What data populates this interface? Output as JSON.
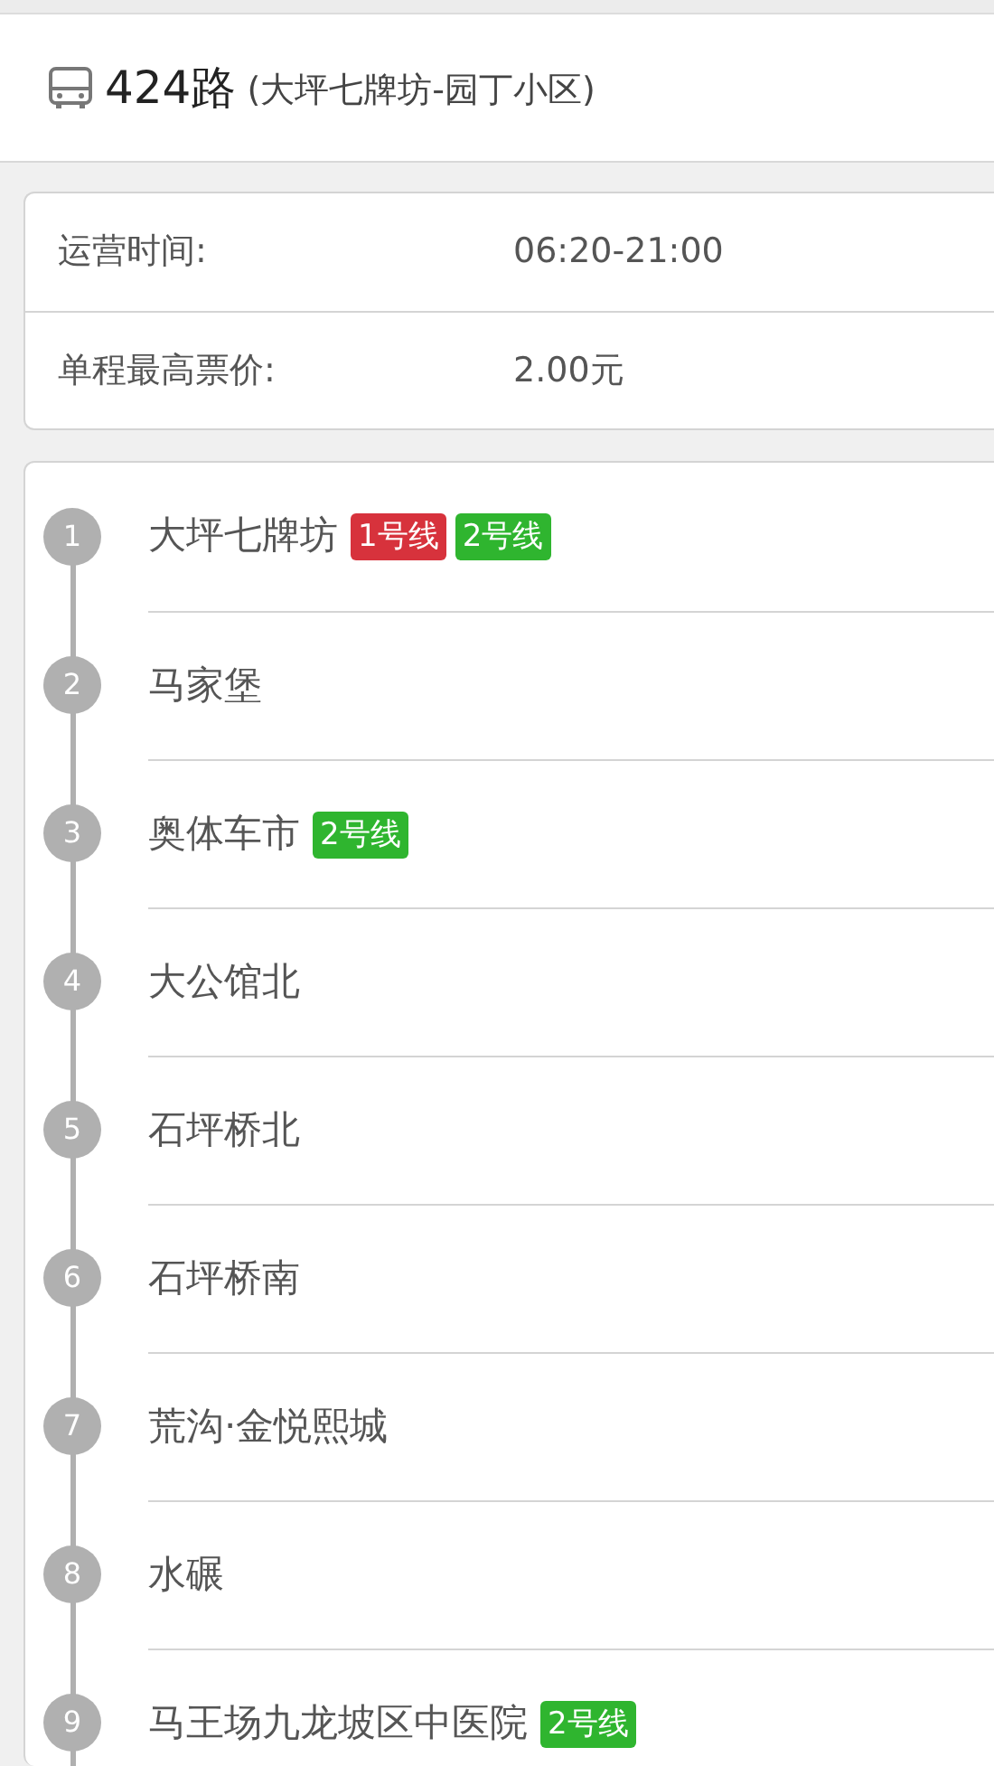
{
  "route": {
    "number": "424路",
    "terminals": "(大坪七牌坊-园丁小区)"
  },
  "info": [
    {
      "label": "运营时间:",
      "value": "06:20-21:00"
    },
    {
      "label": "单程最高票价:",
      "value": "2.00元"
    }
  ],
  "stops": [
    {
      "index": "1",
      "name": "大坪七牌坊",
      "lines": [
        {
          "label": "1号线",
          "color": "#d7323c"
        },
        {
          "label": "2号线",
          "color": "#2fb52f"
        }
      ]
    },
    {
      "index": "2",
      "name": "马家堡"
    },
    {
      "index": "3",
      "name": "奥体车市",
      "lines": [
        {
          "label": "2号线",
          "color": "#2fb52f"
        }
      ]
    },
    {
      "index": "4",
      "name": "大公馆北"
    },
    {
      "index": "5",
      "name": "石坪桥北"
    },
    {
      "index": "6",
      "name": "石坪桥南"
    },
    {
      "index": "7",
      "name": "荒沟·金悦熙城"
    },
    {
      "index": "8",
      "name": "水碾"
    },
    {
      "index": "9",
      "name": "马王场九龙坡区中医院",
      "lines": [
        {
          "label": "2号线",
          "color": "#2fb52f"
        }
      ]
    }
  ]
}
